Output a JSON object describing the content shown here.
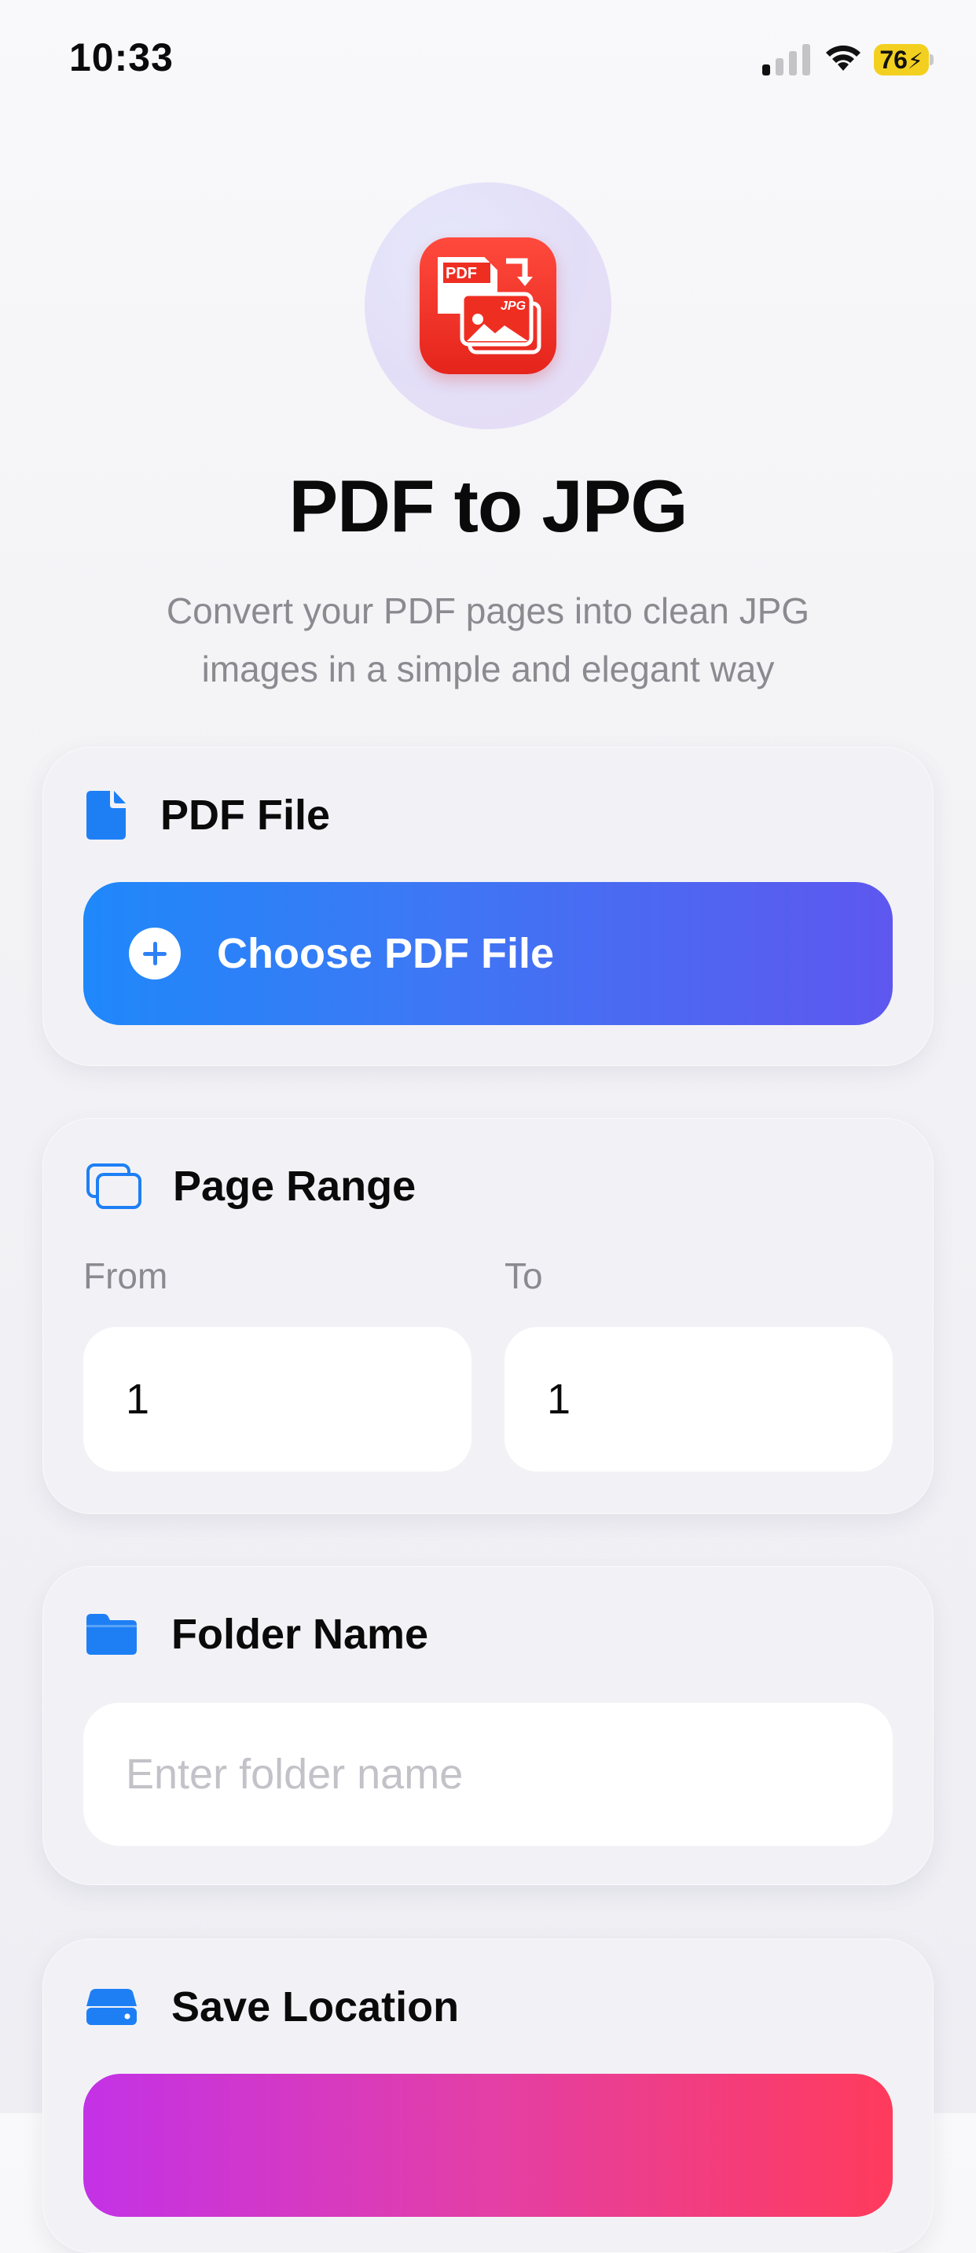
{
  "status_bar": {
    "time": "10:33",
    "battery": "76"
  },
  "hero": {
    "app_icon": "pdf-to-jpg-app-icon",
    "icon_text_pdf": "PDF",
    "icon_text_jpg": "JPG",
    "title": "PDF to JPG",
    "subtitle_line1": "Convert your PDF pages into clean JPG",
    "subtitle_line2": "images in a simple and elegant way"
  },
  "pdf_file": {
    "title": "PDF File",
    "icon": "document-icon",
    "button_label": "Choose PDF File"
  },
  "page_range": {
    "title": "Page Range",
    "icon": "pages-icon",
    "from_label": "From",
    "to_label": "To",
    "from_value": "1",
    "to_value": "1"
  },
  "folder_name": {
    "title": "Folder Name",
    "icon": "folder-icon",
    "placeholder": "Enter folder name",
    "value": ""
  },
  "save_location": {
    "title": "Save Location",
    "icon": "drive-icon"
  },
  "colors": {
    "primary_gradient_start": "#1f88fa",
    "primary_gradient_end": "#5e57ef",
    "save_gradient_start": "#c332e6",
    "save_gradient_end": "#ff3b5c",
    "icon_blue": "#1e7ff5",
    "app_icon_red": "#ef2e22"
  }
}
